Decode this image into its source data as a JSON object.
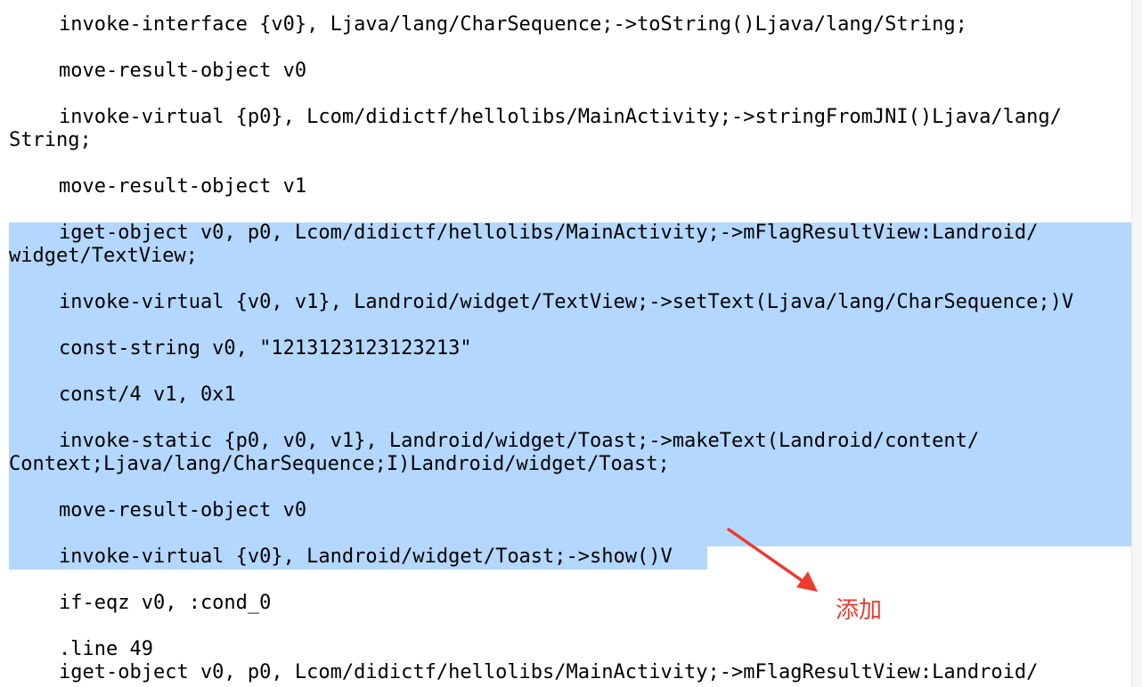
{
  "code": {
    "l1": "invoke-interface {v0}, Ljava/lang/CharSequence;->toString()Ljava/lang/String;",
    "l2": "move-result-object v0",
    "l3a": "invoke-virtual {p0}, Lcom/didictf/hellolibs/MainActivity;->stringFromJNI()Ljava/lang/",
    "l3b": "String;",
    "l4": "move-result-object v1",
    "l5a": "iget-object v0, p0, Lcom/didictf/hellolibs/MainActivity;->mFlagResultView:Landroid/",
    "l5b": "widget/TextView;",
    "l6": "invoke-virtual {v0, v1}, Landroid/widget/TextView;->setText(Ljava/lang/CharSequence;)V",
    "l7": "const-string v0, \"1213123123123213\"",
    "l8": "const/4 v1, 0x1",
    "l9a": "invoke-static {p0, v0, v1}, Landroid/widget/Toast;->makeText(Landroid/content/",
    "l9b": "Context;Ljava/lang/CharSequence;I)Landroid/widget/Toast;",
    "l10": "move-result-object v0",
    "l11": "invoke-virtual {v0}, Landroid/widget/Toast;->show()V",
    "l12": "if-eqz v0, :cond_0",
    "l13": ".line 49",
    "l14": "iget-object v0, p0, Lcom/didictf/hellolibs/MainActivity;->mFlagResultView:Landroid/"
  },
  "annotation": {
    "label": "添加",
    "color": "#ec3b2f"
  },
  "colors": {
    "selection": "#b3d7ff",
    "text": "#000000",
    "background": "#ffffff"
  }
}
